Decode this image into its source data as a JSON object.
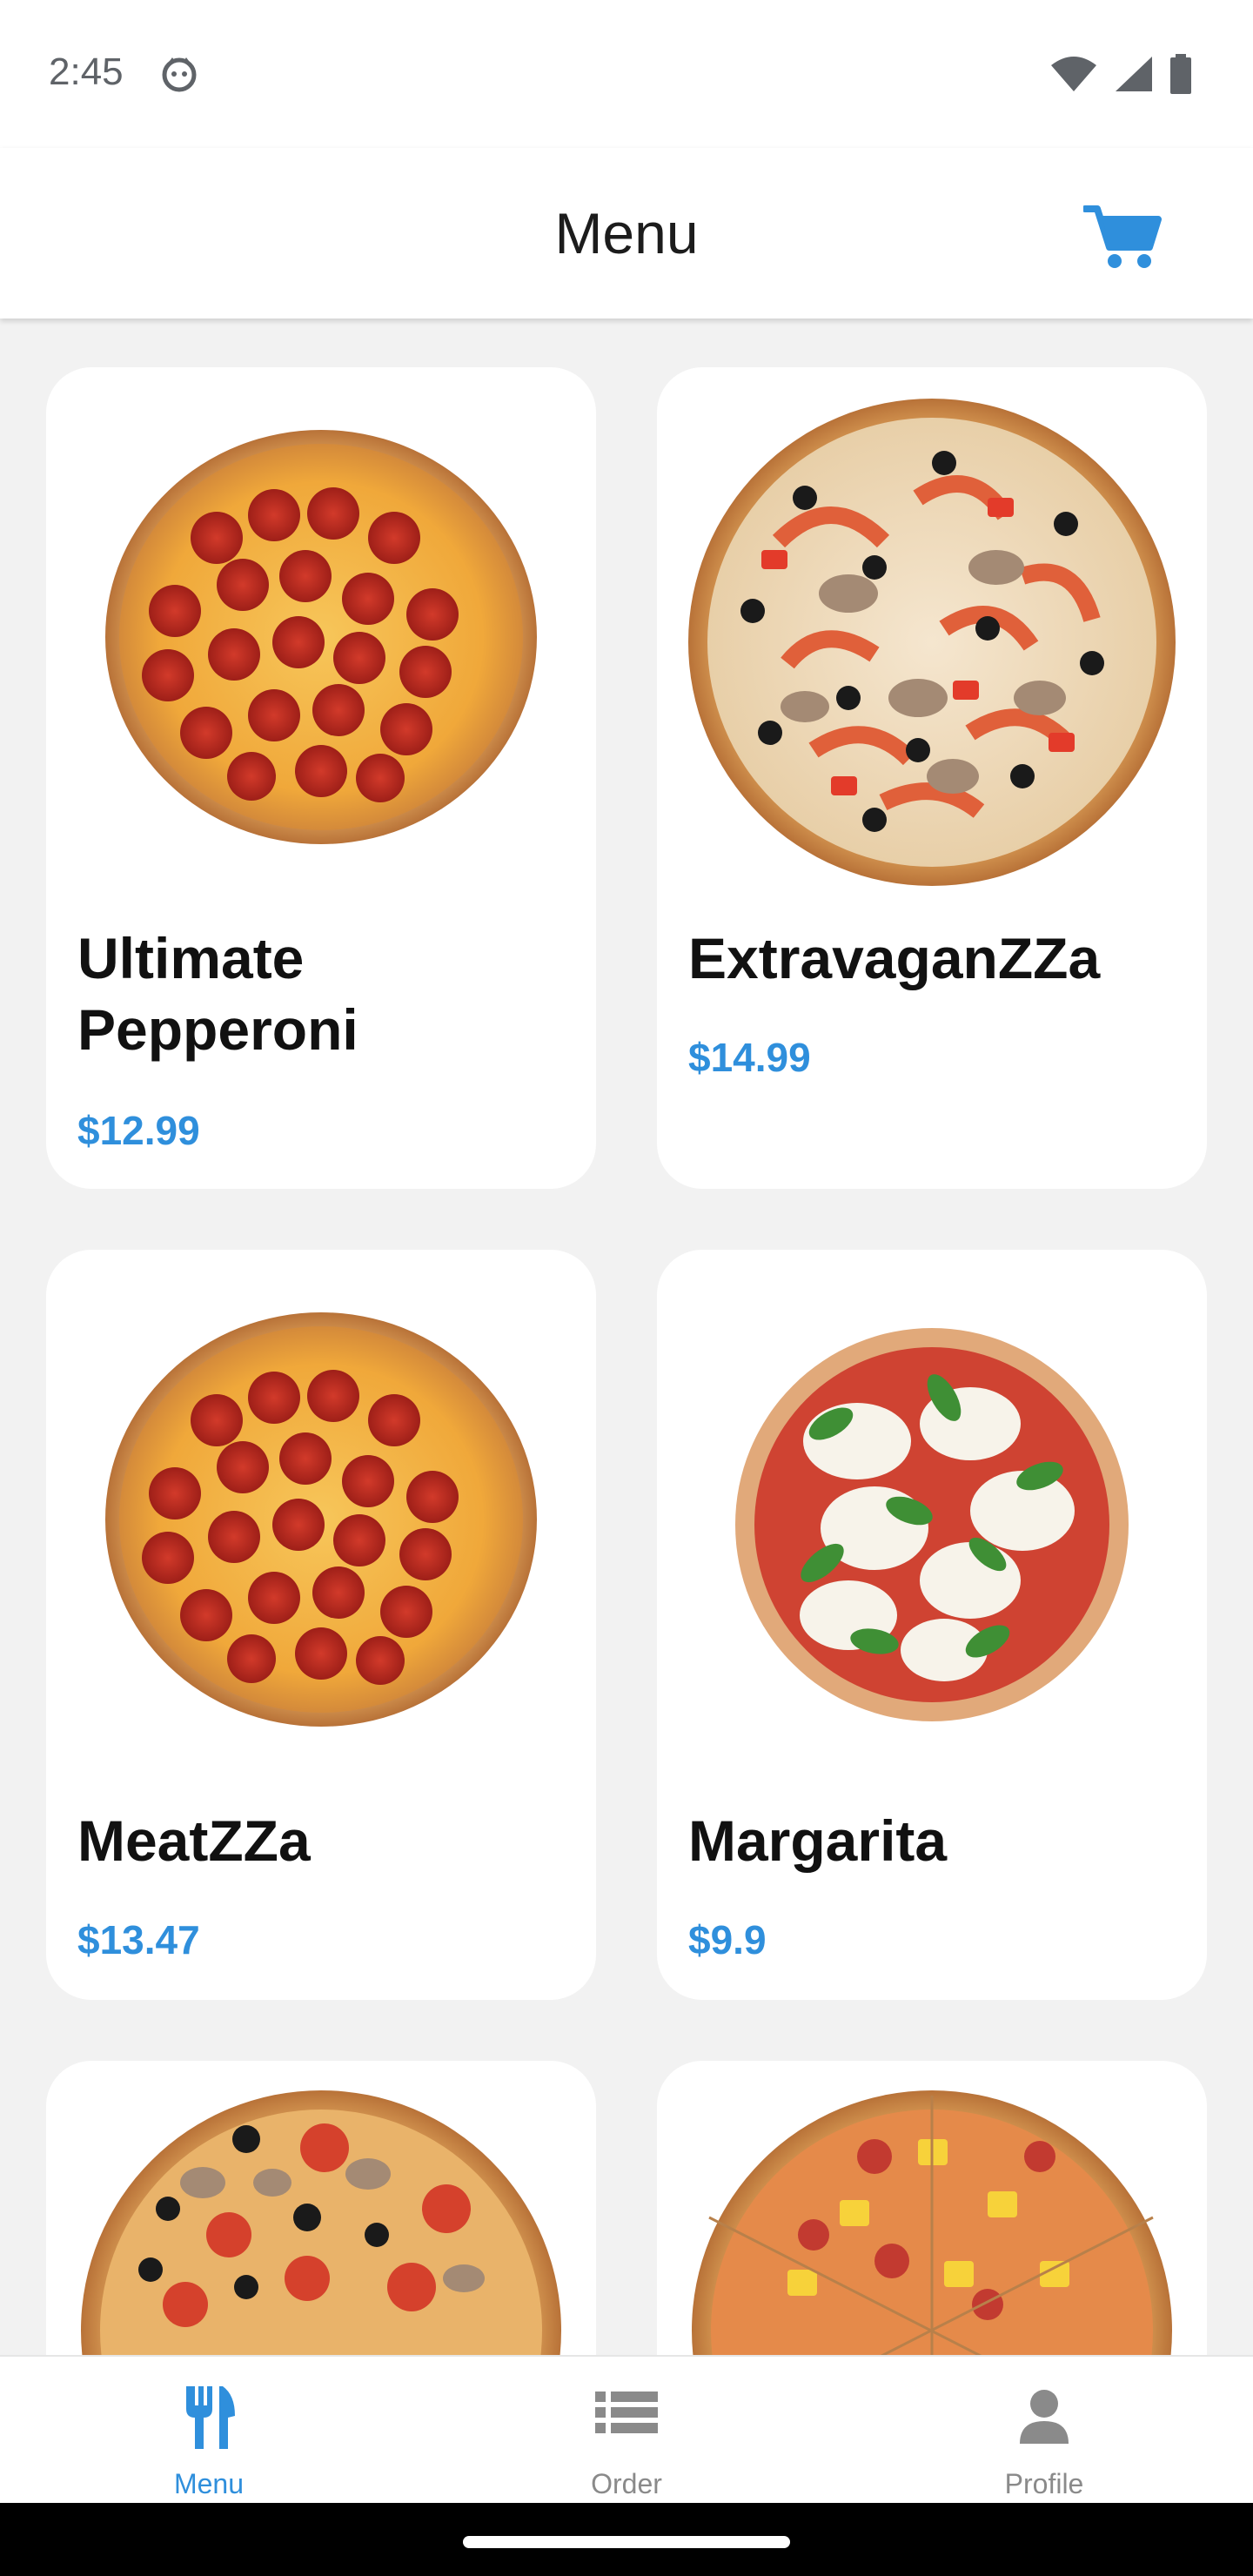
{
  "status_bar": {
    "time": "2:45"
  },
  "header": {
    "title": "Menu",
    "cart_icon": "cart-icon"
  },
  "menu_items": [
    {
      "name": "Ultimate Pepperoni",
      "price": "$12.99",
      "image": "pepperoni-pizza"
    },
    {
      "name": "ExtravaganZZa",
      "price": "$14.99",
      "image": "supreme-pizza"
    },
    {
      "name": "MeatZZa",
      "price": "$13.47",
      "image": "pepperoni-pizza"
    },
    {
      "name": "Margarita",
      "price": "$9.9",
      "image": "margherita-pizza"
    },
    {
      "name": "",
      "price": "",
      "image": "mushroom-olive-pizza"
    },
    {
      "name": "",
      "price": "",
      "image": "hawaiian-pizza"
    }
  ],
  "bottom_nav": [
    {
      "label": "Menu",
      "icon": "fork-knife-icon",
      "active": true
    },
    {
      "label": "Order",
      "icon": "list-icon",
      "active": false
    },
    {
      "label": "Profile",
      "icon": "person-icon",
      "active": false
    }
  ],
  "colors": {
    "accent": "#2f8fdc",
    "inactive": "#8a8a8a",
    "background": "#f2f2f2",
    "card": "#ffffff"
  }
}
